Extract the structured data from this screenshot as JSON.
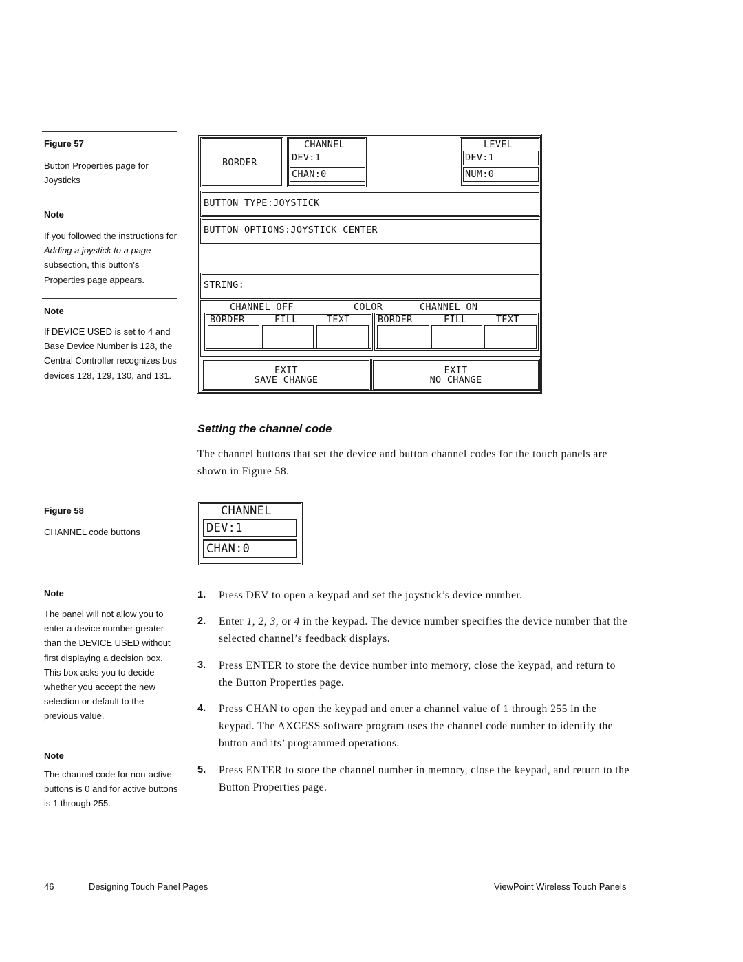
{
  "sidebar": {
    "figure57": {
      "title": "Figure 57",
      "caption": "Button Properties page for Joysticks"
    },
    "note1": {
      "title": "Note",
      "text_before": "If you followed the instructions for ",
      "text_italic": "Adding a joystick to a page",
      "text_after": " subsection, this button's Properties page appears."
    },
    "note2": {
      "title": "Note",
      "text": "If DEVICE USED is set to 4 and Base Device Number is 128, the Central Controller recognizes bus devices 128, 129, 130, and 131."
    },
    "figure58": {
      "title": "Figure 58",
      "caption": "CHANNEL code buttons"
    },
    "note3": {
      "title": "Note",
      "text": "The panel will not allow you to enter a device number greater than the DEVICE USED without first displaying a decision box. This box asks you to decide whether you accept the new selection or default to the previous value."
    },
    "note4": {
      "title": "Note",
      "text": "The channel code for non-active buttons is 0 and for active buttons is 1 through 255."
    }
  },
  "figure57_panel": {
    "border_label": "BORDER",
    "channel": {
      "title": "CHANNEL",
      "dev": "DEV:1",
      "chan": "CHAN:0"
    },
    "level": {
      "title": "LEVEL",
      "dev": "DEV:1",
      "num": "NUM:0"
    },
    "button_type": "BUTTON TYPE:JOYSTICK",
    "button_options": "BUTTON OPTIONS:JOYSTICK CENTER",
    "string": "STRING:",
    "color": {
      "channel_off": "CHANNEL OFF",
      "color": "COLOR",
      "channel_on": "CHANNEL ON",
      "off_cols": [
        "BORDER",
        "FILL",
        "TEXT"
      ],
      "on_cols": [
        "BORDER",
        "FILL",
        "TEXT"
      ]
    },
    "exit_save": {
      "line1": "EXIT",
      "line2": "SAVE CHANGE"
    },
    "exit_no": {
      "line1": "EXIT",
      "line2": "NO CHANGE"
    }
  },
  "section": {
    "heading": "Setting the channel code",
    "intro": "The channel buttons that set the device and button channel codes for the touch panels are shown in Figure 58."
  },
  "figure58_panel": {
    "title": "CHANNEL",
    "dev": "DEV:1",
    "chan": "CHAN:0"
  },
  "steps": [
    {
      "num": "1.",
      "text": "Press DEV to open a keypad and set the joystick’s device number."
    },
    {
      "num": "2.",
      "pre": "Enter ",
      "italic": "1, 2, 3,",
      "mid": " or ",
      "italic2": "4",
      "post": " in the keypad. The device number specifies the device number that the selected channel’s feedback displays."
    },
    {
      "num": "3.",
      "text": "Press ENTER to store the device number into memory, close the keypad, and return to the Button Properties page."
    },
    {
      "num": "4.",
      "text": "Press CHAN to open the keypad and enter a channel value of 1 through 255 in the keypad. The AXCESS software program uses the channel code number to identify the button and its’ programmed operations."
    },
    {
      "num": "5.",
      "text": "Press ENTER to store the channel number in memory, close the keypad, and return to the Button Properties page."
    }
  ],
  "footer": {
    "page_number": "46",
    "chapter": "Designing Touch Panel Pages",
    "product": "ViewPoint Wireless Touch Panels"
  }
}
